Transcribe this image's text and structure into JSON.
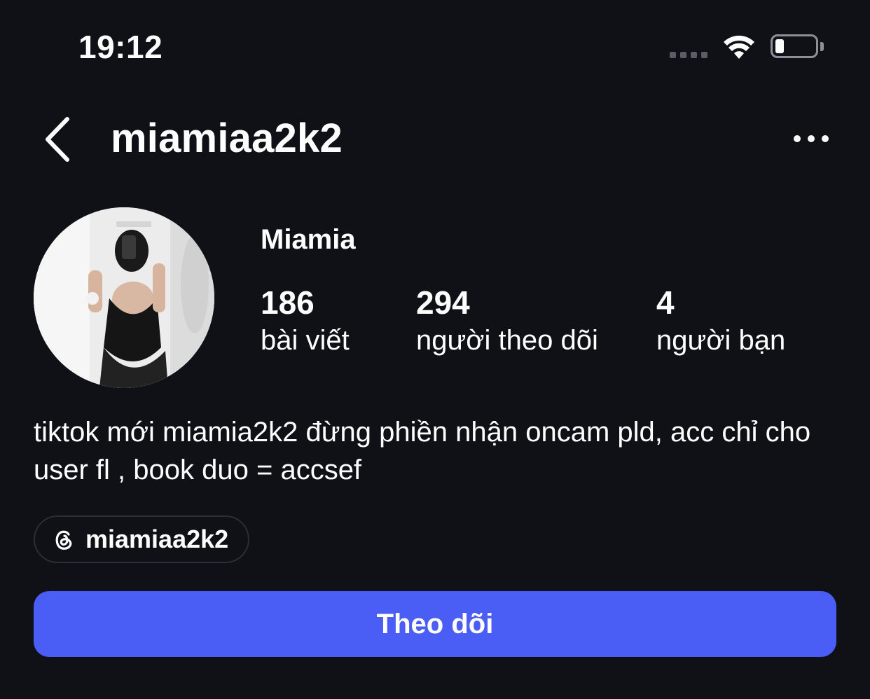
{
  "status_bar": {
    "time": "19:12"
  },
  "header": {
    "username": "miamiaa2k2"
  },
  "profile": {
    "display_name": "Miamia",
    "stats": [
      {
        "value": "186",
        "label": "bài viết"
      },
      {
        "value": "294",
        "label": "người theo dõi"
      },
      {
        "value": "4",
        "label": "người bạn"
      }
    ],
    "bio": "tiktok mới miamia2k2 đừng phiền nhận oncam pld, acc chỉ cho user fl , book duo = accsef",
    "threads_handle": "miamiaa2k2"
  },
  "actions": {
    "follow_label": "Theo dõi"
  },
  "colors": {
    "background": "#0f1117",
    "accent": "#4a5df5"
  },
  "icons": [
    "signal-icon",
    "wifi-icon",
    "battery-icon",
    "back-icon",
    "more-icon",
    "threads-icon"
  ]
}
